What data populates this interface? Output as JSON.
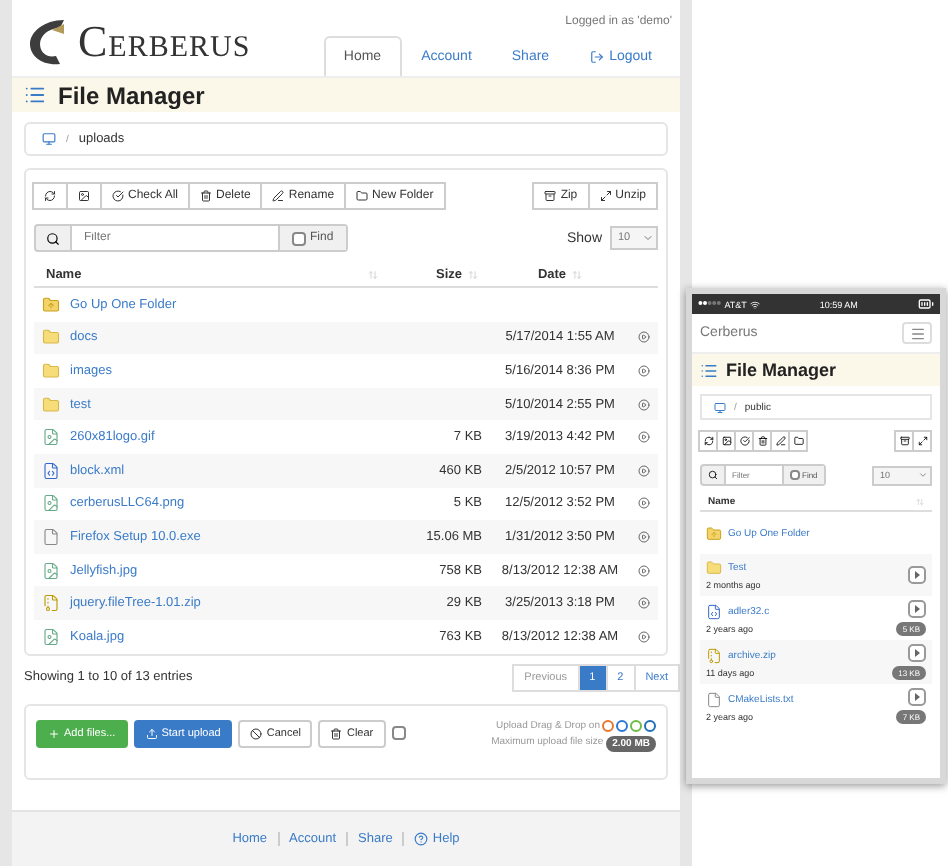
{
  "header": {
    "logo_text": "Cerberus",
    "login_status": "Logged in as 'demo'"
  },
  "nav_tabs": [
    {
      "label": "Home",
      "selected": true,
      "kind": "link"
    },
    {
      "label": "Account",
      "selected": false,
      "kind": "link"
    },
    {
      "label": "Share",
      "selected": false,
      "kind": "link"
    },
    {
      "label": "Logout",
      "selected": false,
      "kind": "logout"
    }
  ],
  "page_title": "File Manager",
  "breadcrumb": {
    "separator": "/",
    "items": [
      "uploads"
    ]
  },
  "toolbar": [
    {
      "kind": "refresh"
    },
    {
      "kind": "image"
    },
    {
      "kind": "check",
      "label": "Check All"
    },
    {
      "kind": "delete",
      "label": "Delete"
    },
    {
      "kind": "rename",
      "label": "Rename"
    },
    {
      "kind": "folder",
      "label": "New Folder"
    }
  ],
  "toolbar_right": [
    {
      "kind": "zip",
      "label": "Zip"
    },
    {
      "kind": "unzip",
      "label": "Unzip"
    }
  ],
  "filter": {
    "placeholder": "Filter",
    "button": "Find"
  },
  "show": {
    "label": "Show",
    "value": "10"
  },
  "table": {
    "columns": [
      "Name",
      "Size",
      "Date"
    ],
    "rows": [
      {
        "kind": "up",
        "name": "Go Up One Folder"
      },
      {
        "kind": "folder",
        "name": "docs",
        "date": "5/17/2014 1:55 AM"
      },
      {
        "kind": "folder",
        "name": "images",
        "date": "5/16/2014 8:36 PM"
      },
      {
        "kind": "folder",
        "name": "test",
        "date": "5/10/2014 2:55 PM"
      },
      {
        "kind": "image",
        "name": "260x81logo.gif",
        "size": "7 KB",
        "date": "3/19/2013 4:42 PM"
      },
      {
        "kind": "code",
        "name": "block.xml",
        "size": "460 KB",
        "date": "2/5/2012 10:57 PM"
      },
      {
        "kind": "image",
        "name": "cerberusLLC64.png",
        "size": "5 KB",
        "date": "12/5/2012 3:52 PM"
      },
      {
        "kind": "file",
        "name": "Firefox Setup 10.0.exe",
        "size": "15.06 MB",
        "date": "1/31/2012 3:50 PM"
      },
      {
        "kind": "image",
        "name": "Jellyfish.jpg",
        "size": "758 KB",
        "date": "8/13/2012 12:38 AM"
      },
      {
        "kind": "archive",
        "name": "jquery.fileTree-1.01.zip",
        "size": "29 KB",
        "date": "3/25/2013 3:18 PM"
      },
      {
        "kind": "image",
        "name": "Koala.jpg",
        "size": "763 KB",
        "date": "8/13/2012 12:38 AM"
      }
    ]
  },
  "entries_info": "Showing 1 to 10 of 13 entries",
  "pagination": [
    {
      "label": "Previous",
      "selected": false
    },
    {
      "label": "1",
      "selected": true
    },
    {
      "label": "2",
      "selected": false
    },
    {
      "label": "Next",
      "selected": false
    }
  ],
  "upload": {
    "buttons": [
      {
        "kind": "add",
        "label": "Add files..."
      },
      {
        "kind": "start",
        "label": "Start upload"
      },
      {
        "kind": "cancel",
        "label": "Cancel"
      },
      {
        "kind": "clear",
        "label": "Clear"
      }
    ],
    "select_all_checked": false,
    "drag_drop": "Upload Drag & Drop on",
    "max_size_label": "Maximum upload file size",
    "max_size": "2.00 MB"
  },
  "footer_links": [
    {
      "kind": "link",
      "label": "Home"
    },
    {
      "kind": "link",
      "label": "Account"
    },
    {
      "kind": "link",
      "label": "Share"
    },
    {
      "kind": "help",
      "label": "Help"
    }
  ],
  "mobile": {
    "carrier": "AT&T",
    "time": "10:59 AM",
    "brand": "Cerberus",
    "title": "File Manager",
    "breadcrumb": {
      "separator": "/",
      "items": [
        "public"
      ]
    },
    "toolbar": [
      {
        "kind": "refresh"
      },
      {
        "kind": "image"
      },
      {
        "kind": "check"
      },
      {
        "kind": "delete"
      },
      {
        "kind": "rename"
      },
      {
        "kind": "folder"
      }
    ],
    "toolbar_right": [
      {
        "kind": "zip"
      },
      {
        "kind": "unzip"
      }
    ],
    "filter": {
      "placeholder": "Filter",
      "button": "Find"
    },
    "show_value": "10",
    "column": "Name",
    "rows": [
      {
        "kind": "up",
        "name": "Go Up One Folder"
      },
      {
        "kind": "folder",
        "name": "Test",
        "age": "2 months ago"
      },
      {
        "kind": "code",
        "name": "adler32.c",
        "age": "2 years ago",
        "size": "5 KB"
      },
      {
        "kind": "archive",
        "name": "archive.zip",
        "age": "11 days ago",
        "size": "13 KB"
      },
      {
        "kind": "file",
        "name": "CMakeLists.txt",
        "age": "2 years ago",
        "size": "7 KB"
      }
    ]
  }
}
